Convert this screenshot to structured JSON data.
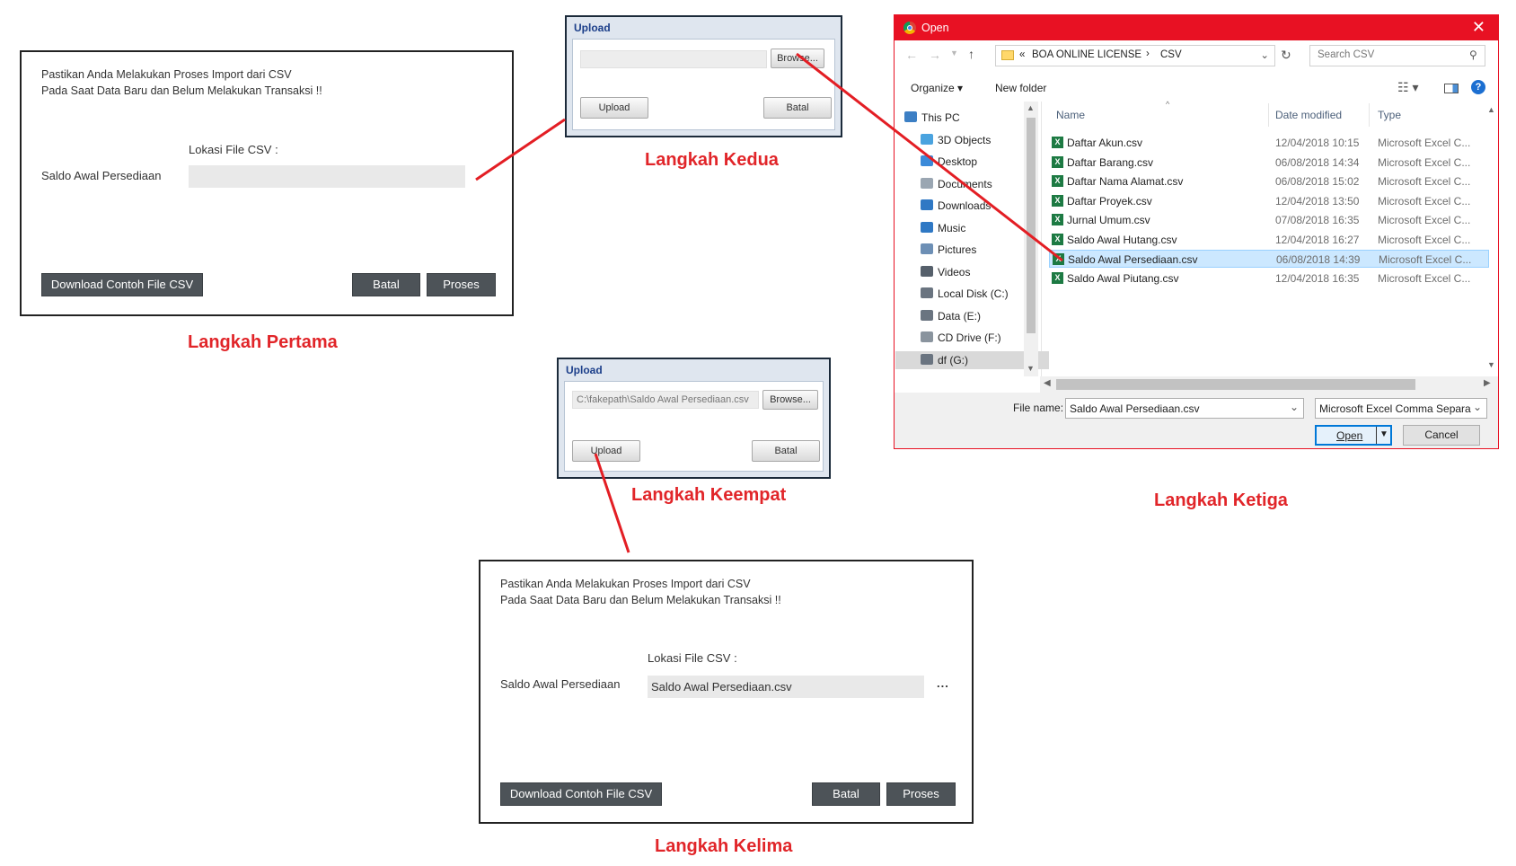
{
  "step1": {
    "caption": "Langkah Pertama",
    "message_line1": "Pastikan Anda Melakukan Proses Import dari CSV",
    "message_line2": "Pada Saat Data Baru dan Belum Melakukan Transaksi !!",
    "lokasi_label": "Lokasi File CSV :",
    "row_label": "Saldo Awal Persediaan",
    "file_value": "",
    "download_button": "Download Contoh File CSV",
    "batal_button": "Batal",
    "proses_button": "Proses"
  },
  "step2": {
    "caption": "Langkah Kedua",
    "title": "Upload",
    "path_value": "",
    "browse_button": "Browse...",
    "upload_button": "Upload",
    "batal_button": "Batal"
  },
  "step3": {
    "caption": "Langkah Ketiga",
    "window_title": "Open",
    "close_glyph": "✕",
    "address": {
      "chevrons": "«",
      "folder": "BOA ONLINE LICENSE",
      "separator": "›",
      "subfolder": "CSV"
    },
    "search_placeholder": "Search CSV",
    "organize_label": "Organize ▾",
    "new_folder_label": "New folder",
    "tree_items": [
      {
        "label": "This PC",
        "icon": "pc-icon",
        "color": "#3c7fc4"
      },
      {
        "label": "3D Objects",
        "icon": "cube-icon",
        "color": "#4aa3df"
      },
      {
        "label": "Desktop",
        "icon": "desktop-icon",
        "color": "#3b8ad9"
      },
      {
        "label": "Documents",
        "icon": "documents-icon",
        "color": "#9aa6b2"
      },
      {
        "label": "Downloads",
        "icon": "downloads-icon",
        "color": "#2f78c4"
      },
      {
        "label": "Music",
        "icon": "music-icon",
        "color": "#2f78c4"
      },
      {
        "label": "Pictures",
        "icon": "pictures-icon",
        "color": "#6d8fb5"
      },
      {
        "label": "Videos",
        "icon": "videos-icon",
        "color": "#56606b"
      },
      {
        "label": "Local Disk (C:)",
        "icon": "disk-icon",
        "color": "#6a7480"
      },
      {
        "label": "Data (E:)",
        "icon": "drive-icon",
        "color": "#6a7480"
      },
      {
        "label": "CD Drive (F:)",
        "icon": "cd-icon",
        "color": "#8a949e"
      },
      {
        "label": "df (G:)",
        "icon": "drive-icon",
        "color": "#6a7480"
      }
    ],
    "columns": {
      "name": "Name",
      "date": "Date modified",
      "type": "Type"
    },
    "files": [
      {
        "name": "Daftar Akun.csv",
        "date": "12/04/2018 10:15",
        "type": "Microsoft Excel C..."
      },
      {
        "name": "Daftar Barang.csv",
        "date": "06/08/2018 14:34",
        "type": "Microsoft Excel C..."
      },
      {
        "name": "Daftar Nama Alamat.csv",
        "date": "06/08/2018 15:02",
        "type": "Microsoft Excel C..."
      },
      {
        "name": "Daftar Proyek.csv",
        "date": "12/04/2018 13:50",
        "type": "Microsoft Excel C..."
      },
      {
        "name": "Jurnal Umum.csv",
        "date": "07/08/2018 16:35",
        "type": "Microsoft Excel C..."
      },
      {
        "name": "Saldo Awal Hutang.csv",
        "date": "12/04/2018 16:27",
        "type": "Microsoft Excel C..."
      },
      {
        "name": "Saldo Awal Persediaan.csv",
        "date": "06/08/2018 14:39",
        "type": "Microsoft Excel C..."
      },
      {
        "name": "Saldo Awal Piutang.csv",
        "date": "12/04/2018 16:35",
        "type": "Microsoft Excel C..."
      }
    ],
    "selected_file_index": 6,
    "file_name_label": "File name:",
    "file_name_value": "Saldo Awal Persediaan.csv",
    "file_type_value": "Microsoft Excel Comma Separa",
    "open_button": "Open",
    "cancel_button": "Cancel"
  },
  "step4": {
    "caption": "Langkah Keempat",
    "title": "Upload",
    "path_value": "C:\\fakepath\\Saldo Awal Persediaan.csv",
    "browse_button": "Browse...",
    "upload_button": "Upload",
    "batal_button": "Batal"
  },
  "step5": {
    "caption": "Langkah Kelima",
    "message_line1": "Pastikan Anda Melakukan Proses Import dari CSV",
    "message_line2": "Pada Saat Data Baru dan Belum Melakukan Transaksi !!",
    "lokasi_label": "Lokasi File CSV :",
    "row_label": "Saldo Awal Persediaan",
    "file_value": "Saldo Awal Persediaan.csv",
    "dots": "...",
    "download_button": "Download Contoh File CSV",
    "batal_button": "Batal",
    "proses_button": "Proses"
  },
  "colors": {
    "caption_red": "#e12529",
    "arrow_red": "#e31e24",
    "dialog_title_blue": "#1c3f8a",
    "open_titlebar_red": "#e81123",
    "selection_blue": "#cce8ff",
    "dark_button": "#4d5358"
  }
}
